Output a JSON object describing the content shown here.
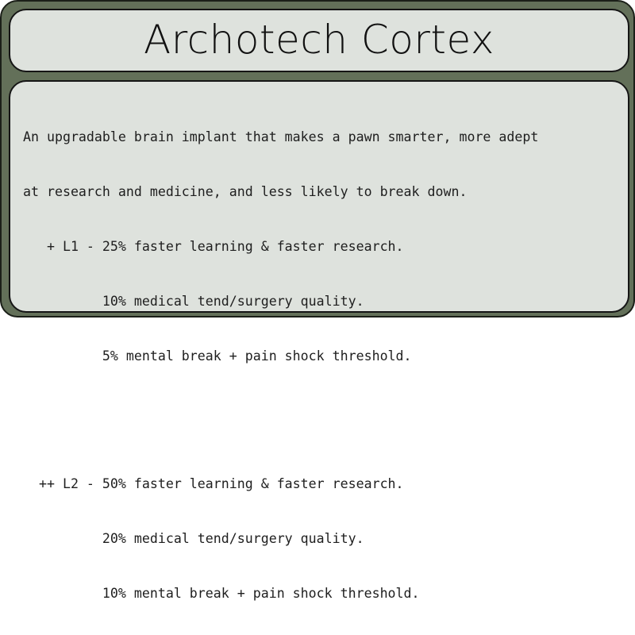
{
  "card": {
    "title": "Archotech Cortex",
    "intro_lines": [
      "An upgradable brain implant that makes a pawn smarter, more adept",
      "at research and medicine, and less likely to break down."
    ],
    "levels": [
      {
        "lines": [
          "   + L1 - 25% faster learning & faster research.",
          "          10% medical tend/surgery quality.",
          "          5% mental break + pain shock threshold."
        ]
      },
      {
        "lines": [
          "  ++ L2 - 50% faster learning & faster research.",
          "          20% medical tend/surgery quality.",
          "          10% mental break + pain shock threshold."
        ]
      }
    ]
  }
}
